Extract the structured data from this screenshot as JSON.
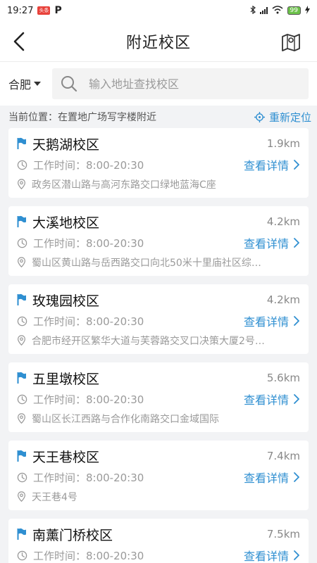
{
  "status_bar": {
    "time": "19:27",
    "news_badge": "头条",
    "app_badge": "P",
    "battery": "99"
  },
  "header": {
    "title": "附近校区"
  },
  "search": {
    "city": "合肥",
    "placeholder": "输入地址查找校区"
  },
  "location": {
    "current": "当前位置：在置地广场写字楼附近",
    "relocate_label": "重新定位"
  },
  "campuses": [
    {
      "name": "天鹅湖校区",
      "distance": "1.9km",
      "hours": "工作时间：8:00-20:30",
      "detail_label": "查看详情",
      "address": "政务区潜山路与高河东路交口绿地蓝海C座"
    },
    {
      "name": "大溪地校区",
      "distance": "4.2km",
      "hours": "工作时间：8:00-20:30",
      "detail_label": "查看详情",
      "address": "蜀山区黄山路与岳西路交口向北50米十里庙社区综…"
    },
    {
      "name": "玫瑰园校区",
      "distance": "4.2km",
      "hours": "工作时间：8:00-20:30",
      "detail_label": "查看详情",
      "address": "合肥市经开区繁华大道与芙蓉路交叉口决策大厦2号…"
    },
    {
      "name": "五里墩校区",
      "distance": "5.6km",
      "hours": "工作时间：8:00-20:30",
      "detail_label": "查看详情",
      "address": "蜀山区长江西路与合作化南路交口金域国际"
    },
    {
      "name": "天王巷校区",
      "distance": "7.4km",
      "hours": "工作时间：8:00-20:30",
      "detail_label": "查看详情",
      "address": "天王巷4号"
    },
    {
      "name": "南薰门桥校区",
      "distance": "7.5km",
      "hours": "工作时间：8:00-20:30",
      "detail_label": "查看详情",
      "address": ""
    }
  ],
  "colors": {
    "accent": "#2f8fd1",
    "background": "#f2f3f5"
  }
}
